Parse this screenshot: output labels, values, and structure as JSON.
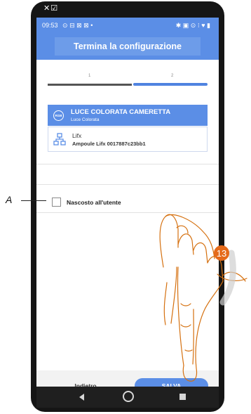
{
  "window": {
    "corner_icons": "✕☑"
  },
  "statusbar": {
    "time": "09:53",
    "left_icons": "⊙ ⊟ ⊠ ⊠ •",
    "right_icons": "✱ ▣ ⊙ ⁝ ♥ ▮"
  },
  "header": {
    "title": "Termina la configurazione"
  },
  "stepper": {
    "step1": "1",
    "step2": "2",
    "current_step": 2,
    "total_steps": 2
  },
  "device": {
    "icon_label": "RGB",
    "name": "LUCE COLORATA CAMERETTA",
    "type": "Luce Colorata"
  },
  "integration": {
    "provider": "Lifx",
    "device": "Ampoule Lifx 0017887c23bb1"
  },
  "option": {
    "hidden_label": "Nascosto all'utente",
    "checked": false
  },
  "footer": {
    "back_label": "Indietro",
    "save_label": "SALVA"
  },
  "annotation": {
    "label": "A",
    "step": "13"
  },
  "colors": {
    "accent": "#5b8ee6",
    "badge": "#e56a1a",
    "hand_stroke": "#d5700f"
  },
  "icons": {
    "back": "triangle-back-icon",
    "home": "circle-home-icon",
    "recent": "square-recent-icon",
    "network": "network-icon"
  }
}
